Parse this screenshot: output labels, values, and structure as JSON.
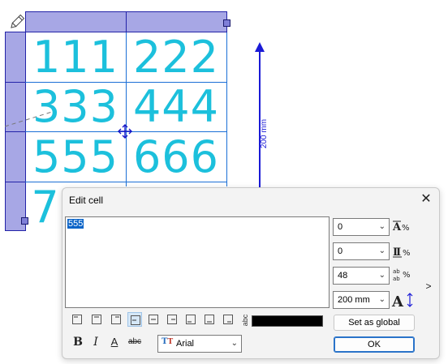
{
  "table": {
    "cells": [
      "111",
      "222",
      "333",
      "444",
      "555",
      "666",
      "7"
    ]
  },
  "dimension": {
    "label": "200 mm"
  },
  "dialog": {
    "title": "Edit cell",
    "cell_text": "555",
    "fields": {
      "field1": "0",
      "field2": "0",
      "font_size": "48",
      "width": "200 mm"
    },
    "field_icons": [
      "letter-spacing-icon",
      "line-spacing-icon",
      "font-size-icon",
      "text-height-icon"
    ],
    "alignment_buttons": [
      "align-top-left",
      "align-top-center",
      "align-top-right",
      "align-middle-left",
      "align-middle-center",
      "align-middle-right",
      "align-bottom-left",
      "align-bottom-center",
      "align-bottom-right"
    ],
    "selected_alignment_index": 3,
    "vertical_text_label": "abc",
    "color_swatch": "#000000",
    "format": {
      "bold": "B",
      "italic": "I",
      "underline": "A",
      "strike": "abc"
    },
    "font": {
      "value": "Arial"
    },
    "set_global_label": "Set as global",
    "ok_label": "OK",
    "expand_label": ">"
  },
  "colors": {
    "cell_text": "#1cc0dc",
    "grid": "#1b6fd6",
    "header_fill": "#a7a7e5",
    "dimension": "#1a1ad6",
    "selection": "#0a64c8"
  }
}
